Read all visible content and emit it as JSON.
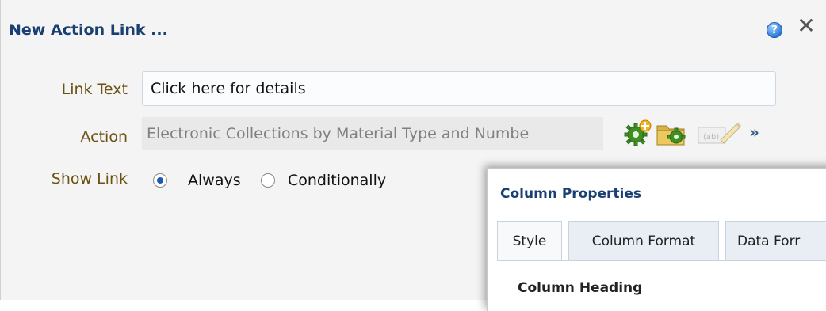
{
  "dialog": {
    "title": "New Action Link ...",
    "help_icon": "?",
    "close_icon": "✕"
  },
  "form": {
    "link_text": {
      "label": "Link Text",
      "value": "Click here for details"
    },
    "action": {
      "label": "Action",
      "value": "Electronic Collections by Material Type and Numbe"
    },
    "show_link": {
      "label": "Show Link",
      "options": [
        {
          "label": "Always",
          "selected": true
        },
        {
          "label": "Conditionally",
          "selected": false
        }
      ]
    },
    "more_icon": "»"
  },
  "column_properties": {
    "title": "Column Properties",
    "tabs": [
      {
        "label": "Style",
        "active": true
      },
      {
        "label": "Column Format",
        "active": false
      },
      {
        "label": "Data Forr",
        "active": false
      }
    ],
    "section_heading": "Column Heading"
  },
  "colors": {
    "title_blue": "#1a3f73",
    "label_brown": "#6b5212",
    "radio_blue": "#1d59b8"
  },
  "icons": [
    "help-icon",
    "close-icon",
    "gear-add-icon",
    "folder-gear-icon",
    "edit-params-icon",
    "more-icon"
  ]
}
